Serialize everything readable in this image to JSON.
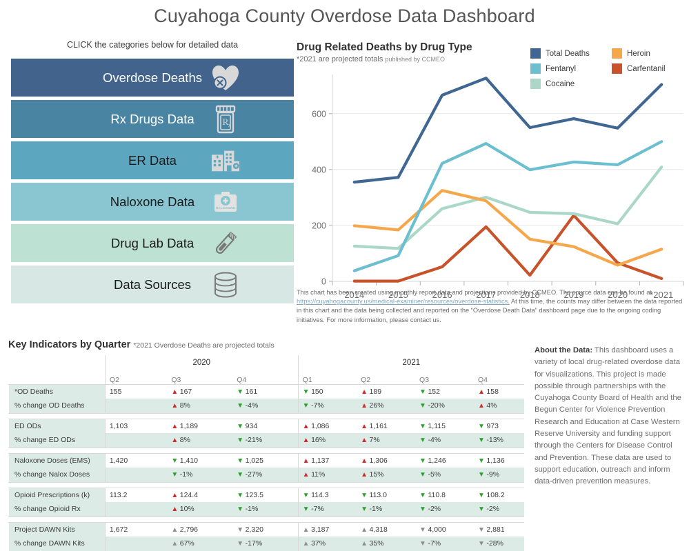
{
  "title": "Cuyahoga County Overdose Data Dashboard",
  "nav": {
    "hint": "CLICK the categories below for detailed data",
    "items": [
      {
        "label": "Overdose Deaths",
        "color": "#41638c",
        "text_color": "#ffffff",
        "icon": "heart-x-icon",
        "icon_color": "#d8d8d8"
      },
      {
        "label": "Rx Drugs Data",
        "color": "#4984a3",
        "text_color": "#ffffff",
        "icon": "pill-bottle-rx-icon",
        "icon_color": "#d8d8d8"
      },
      {
        "label": "ER Data",
        "color": "#5ca7bf",
        "text_color": "#1a1a1a",
        "icon": "hospital-icon",
        "icon_color": "#d8d8d8"
      },
      {
        "label": "Naloxone Data",
        "color": "#8ac6d1",
        "text_color": "#1a1a1a",
        "icon": "naloxone-kit-icon",
        "icon_color": "#e2e2e2"
      },
      {
        "label": "Drug Lab Data",
        "color": "#bde2d4",
        "text_color": "#1a1a1a",
        "icon": "test-tube-icon",
        "icon_color": "#7a7a7a"
      },
      {
        "label": "Data Sources",
        "color": "#d7e8e4",
        "text_color": "#1a1a1a",
        "icon": "database-icon",
        "icon_color": "#7a7a7a"
      }
    ]
  },
  "chart_panel": {
    "title": "Drug Related Deaths by Drug Type",
    "subtitle": "*2021 are projected totals",
    "published_by": "published by CCMEO",
    "note_part1": "This chart has been created using monthly report data and projections provided by CCMEO.  The source data can be found at ",
    "note_link": "https://cuyahogacounty.us/medical-examiner/resources/overdose-statistics.",
    "note_part2": "  At this time, the counts may  differ between the data reported in this chart and the data being collected and reported on the “Overdose Death Data” dashboard page due to the ongoing coding initiatives.  For more information, please contact us."
  },
  "chart_data": {
    "type": "line",
    "title": "Drug Related Deaths by Drug Type",
    "subtitle": "*2021 are projected totals published by CCMEO",
    "xlabel": "",
    "ylabel": "",
    "categories": [
      "2014",
      "2015",
      "2016",
      "2017",
      "2018",
      "2019",
      "2020",
      "*2021"
    ],
    "ylim": [
      0,
      740
    ],
    "yticks": [
      0,
      200,
      400,
      600
    ],
    "grid": "horizontal",
    "legend_position": "top-right",
    "series": [
      {
        "name": "Total Deaths",
        "color": "#3f6791",
        "values": [
          355,
          372,
          666,
          727,
          550,
          582,
          548,
          704
        ]
      },
      {
        "name": "Fentanyl",
        "color": "#6cbfcf",
        "values": [
          38,
          92,
          422,
          493,
          399,
          427,
          417,
          500
        ]
      },
      {
        "name": "Cocaine",
        "color": "#abd7c8",
        "values": [
          126,
          118,
          260,
          301,
          247,
          242,
          206,
          409
        ]
      },
      {
        "name": "Heroin",
        "color": "#f4a84b",
        "values": [
          199,
          184,
          325,
          288,
          151,
          124,
          58,
          115
        ]
      },
      {
        "name": "Carfentanil",
        "color": "#c8532b",
        "values": [
          1,
          1,
          52,
          195,
          22,
          236,
          66,
          10
        ]
      }
    ]
  },
  "key_indicators": {
    "heading": "Key Indicators by Quarter",
    "heading_note": "*2021 Overdose Deaths are projected totals",
    "year_headers": [
      {
        "label": "2020",
        "span": 3
      },
      {
        "label": "2021",
        "span": 4
      }
    ],
    "quarter_headers": [
      "Q2",
      "Q3",
      "Q4",
      "Q1",
      "Q2",
      "Q3",
      "Q4"
    ],
    "groups": [
      {
        "value_row": {
          "label": "*OD Deaths",
          "cells": [
            {
              "dir": "none",
              "text": "155"
            },
            {
              "dir": "up",
              "text": "167"
            },
            {
              "dir": "down",
              "text": "161"
            },
            {
              "dir": "down",
              "text": "150"
            },
            {
              "dir": "up",
              "text": "189"
            },
            {
              "dir": "down",
              "text": "152"
            },
            {
              "dir": "up",
              "text": "158"
            }
          ]
        },
        "change_row": {
          "label": "% change OD Deaths",
          "cells": [
            {
              "dir": "none",
              "text": ""
            },
            {
              "dir": "up",
              "text": "8%"
            },
            {
              "dir": "down",
              "text": "-4%"
            },
            {
              "dir": "down",
              "text": "-7%"
            },
            {
              "dir": "up",
              "text": "26%"
            },
            {
              "dir": "down",
              "text": "-20%"
            },
            {
              "dir": "up",
              "text": "4%"
            }
          ]
        }
      },
      {
        "value_row": {
          "label": "ED ODs",
          "cells": [
            {
              "dir": "none",
              "text": "1,103"
            },
            {
              "dir": "up",
              "text": "1,189"
            },
            {
              "dir": "down",
              "text": "934"
            },
            {
              "dir": "up",
              "text": "1,086"
            },
            {
              "dir": "up",
              "text": "1,161"
            },
            {
              "dir": "down",
              "text": "1,115"
            },
            {
              "dir": "down",
              "text": "973"
            }
          ]
        },
        "change_row": {
          "label": "% change ED ODs",
          "cells": [
            {
              "dir": "none",
              "text": ""
            },
            {
              "dir": "up",
              "text": "8%"
            },
            {
              "dir": "down",
              "text": "-21%"
            },
            {
              "dir": "up",
              "text": "16%"
            },
            {
              "dir": "up",
              "text": "7%"
            },
            {
              "dir": "down",
              "text": "-4%"
            },
            {
              "dir": "down",
              "text": "-13%"
            }
          ]
        }
      },
      {
        "value_row": {
          "label": "Naloxone Doses (EMS)",
          "cells": [
            {
              "dir": "none",
              "text": "1,420"
            },
            {
              "dir": "down",
              "text": "1,410"
            },
            {
              "dir": "down",
              "text": "1,025"
            },
            {
              "dir": "up",
              "text": "1,137"
            },
            {
              "dir": "up",
              "text": "1,306"
            },
            {
              "dir": "down",
              "text": "1,246"
            },
            {
              "dir": "down",
              "text": "1,136"
            }
          ]
        },
        "change_row": {
          "label": "% change Nalox Doses",
          "cells": [
            {
              "dir": "none",
              "text": ""
            },
            {
              "dir": "down",
              "text": "-1%"
            },
            {
              "dir": "down",
              "text": "-27%"
            },
            {
              "dir": "up",
              "text": "11%"
            },
            {
              "dir": "up",
              "text": "15%"
            },
            {
              "dir": "down",
              "text": "-5%"
            },
            {
              "dir": "down",
              "text": "-9%"
            }
          ]
        }
      },
      {
        "value_row": {
          "label": "Opioid Prescriptions (k)",
          "cells": [
            {
              "dir": "none",
              "text": "113.2"
            },
            {
              "dir": "up",
              "text": "124.4"
            },
            {
              "dir": "down",
              "text": "123.5"
            },
            {
              "dir": "down",
              "text": "114.3"
            },
            {
              "dir": "down",
              "text": "113.0"
            },
            {
              "dir": "down",
              "text": "110.8"
            },
            {
              "dir": "down",
              "text": "108.2"
            }
          ]
        },
        "change_row": {
          "label": "% change Opioid Rx",
          "cells": [
            {
              "dir": "none",
              "text": ""
            },
            {
              "dir": "up",
              "text": "10%"
            },
            {
              "dir": "down",
              "text": "-1%"
            },
            {
              "dir": "down",
              "text": "-7%"
            },
            {
              "dir": "down",
              "text": "-1%"
            },
            {
              "dir": "down",
              "text": "-2%"
            },
            {
              "dir": "down",
              "text": "-2%"
            }
          ]
        }
      },
      {
        "value_row": {
          "label": "Project DAWN Kits",
          "cells": [
            {
              "dir": "none",
              "text": "1,672"
            },
            {
              "dir": "gray-up",
              "text": "2,796"
            },
            {
              "dir": "gray-down",
              "text": "2,320"
            },
            {
              "dir": "gray-up",
              "text": "3,187"
            },
            {
              "dir": "gray-up",
              "text": "4,318"
            },
            {
              "dir": "gray-down",
              "text": "4,000"
            },
            {
              "dir": "gray-down",
              "text": "2,881"
            }
          ]
        },
        "change_row": {
          "label": "% change DAWN Kits",
          "cells": [
            {
              "dir": "none",
              "text": ""
            },
            {
              "dir": "gray-up",
              "text": "67%"
            },
            {
              "dir": "gray-down",
              "text": "-17%"
            },
            {
              "dir": "gray-up",
              "text": "37%"
            },
            {
              "dir": "gray-up",
              "text": "35%"
            },
            {
              "dir": "gray-down",
              "text": "-7%"
            },
            {
              "dir": "gray-down",
              "text": "-28%"
            }
          ]
        }
      }
    ]
  },
  "about": {
    "heading": "About the Data:",
    "body": " This dashboard uses a variety of local drug-related overdose data for visualizations. This project is made possible through partnerships with the Cuyahoga County Board of Health and the Begun Center for Violence Prevention Research and Education at Case Western Reserve University and funding support through the Centers for Disease Control and Prevention.  These data are used to support education, outreach and inform data-driven prevention measures."
  }
}
